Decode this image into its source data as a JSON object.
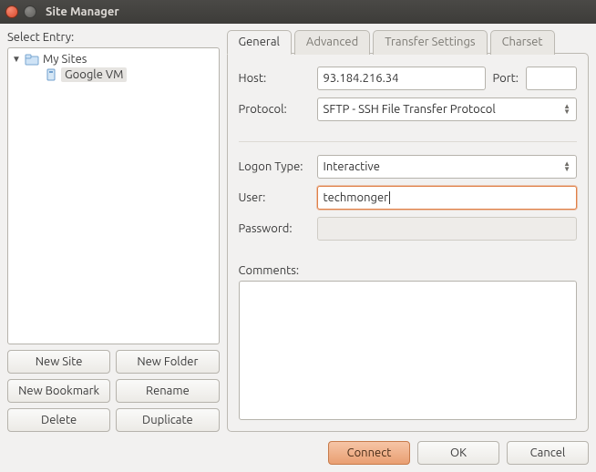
{
  "window_title": "Site Manager",
  "left": {
    "select_entry_label": "Select Entry:",
    "tree": {
      "root_label": "My Sites",
      "items": [
        {
          "label": "Google VM",
          "selected": true
        }
      ]
    },
    "buttons": {
      "new_site": "New Site",
      "new_folder": "New Folder",
      "new_bookmark": "New Bookmark",
      "rename": "Rename",
      "delete": "Delete",
      "duplicate": "Duplicate"
    }
  },
  "tabs": {
    "general": "General",
    "advanced": "Advanced",
    "transfer": "Transfer Settings",
    "charset": "Charset"
  },
  "general": {
    "host_label": "Host:",
    "host_value": "93.184.216.34",
    "port_label": "Port:",
    "port_value": "",
    "protocol_label": "Protocol:",
    "protocol_value": "SFTP - SSH File Transfer Protocol",
    "logon_type_label": "Logon Type:",
    "logon_type_value": "Interactive",
    "user_label": "User:",
    "user_value": "techmonger",
    "password_label": "Password:",
    "password_value": "",
    "comments_label": "Comments:",
    "comments_value": ""
  },
  "footer": {
    "connect": "Connect",
    "ok": "OK",
    "cancel": "Cancel"
  }
}
